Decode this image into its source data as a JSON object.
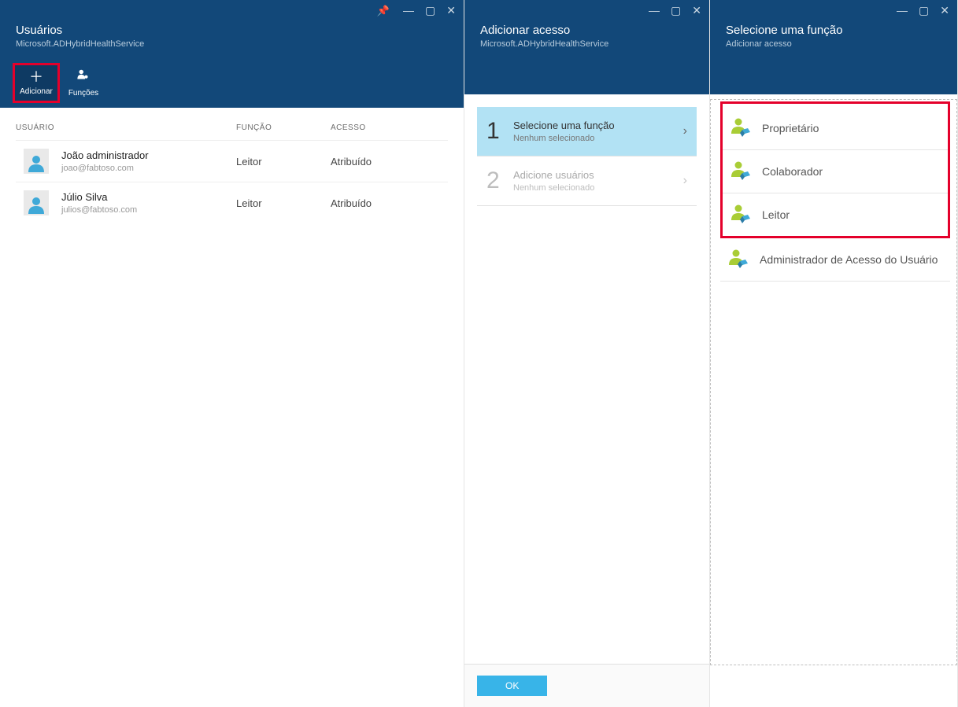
{
  "blade1": {
    "title": "Usuários",
    "subtitle": "Microsoft.ADHybridHealthService",
    "toolbar": {
      "add_label": "Adicionar",
      "roles_label": "Funções"
    },
    "columns": {
      "user": "USUÁRIO",
      "role": "FUNÇÃO",
      "access": "ACESSO"
    },
    "rows": [
      {
        "name": "João administrador",
        "email": "joao@fabtoso.com",
        "role": "Leitor",
        "access": "Atribuído"
      },
      {
        "name": "Júlio Silva",
        "email": "julios@fabtoso.com",
        "role": "Leitor",
        "access": "Atribuído"
      }
    ]
  },
  "blade2": {
    "title": "Adicionar acesso",
    "subtitle": "Microsoft.ADHybridHealthService",
    "steps": [
      {
        "num": "1",
        "title": "Selecione uma função",
        "subtitle": "Nenhum selecionado",
        "active": true
      },
      {
        "num": "2",
        "title": "Adicione usuários",
        "subtitle": "Nenhum selecionado",
        "active": false
      }
    ],
    "ok_label": "OK"
  },
  "blade3": {
    "title": "Selecione uma função",
    "subtitle": "Adicionar acesso",
    "roles_highlighted": [
      "Proprietário",
      "Colaborador",
      "Leitor"
    ],
    "roles_rest": [
      "Administrador de Acesso do Usuário"
    ]
  }
}
